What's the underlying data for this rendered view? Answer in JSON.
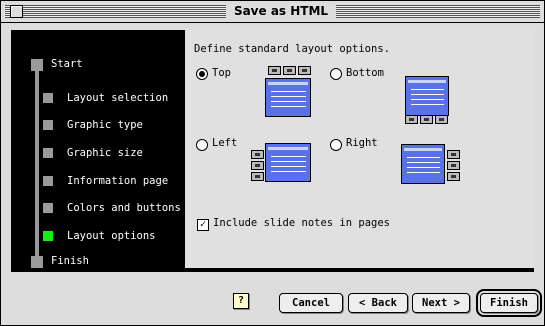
{
  "window": {
    "title": "Save as HTML"
  },
  "sidebar": {
    "start_label": "Start",
    "finish_label": "Finish",
    "steps": [
      {
        "label": "Layout selection",
        "active": false
      },
      {
        "label": "Graphic type",
        "active": false
      },
      {
        "label": "Graphic size",
        "active": false
      },
      {
        "label": "Information page",
        "active": false
      },
      {
        "label": "Colors and buttons",
        "active": false
      },
      {
        "label": "Layout options",
        "active": true
      }
    ]
  },
  "content": {
    "heading": "Define standard layout options.",
    "options": {
      "top": {
        "label": "Top",
        "selected": true
      },
      "bottom": {
        "label": "Bottom",
        "selected": false
      },
      "left": {
        "label": "Left",
        "selected": false
      },
      "right": {
        "label": "Right",
        "selected": false
      }
    },
    "include_notes": {
      "label": "Include slide notes in pages",
      "checked": true
    }
  },
  "footer": {
    "help_label": "?",
    "cancel_label": "Cancel",
    "back_label": "< Back",
    "next_label": "Next >",
    "finish_label": "Finish"
  },
  "colors": {
    "active_step": "#11ee11",
    "preview_blue": "#5a72e8"
  }
}
